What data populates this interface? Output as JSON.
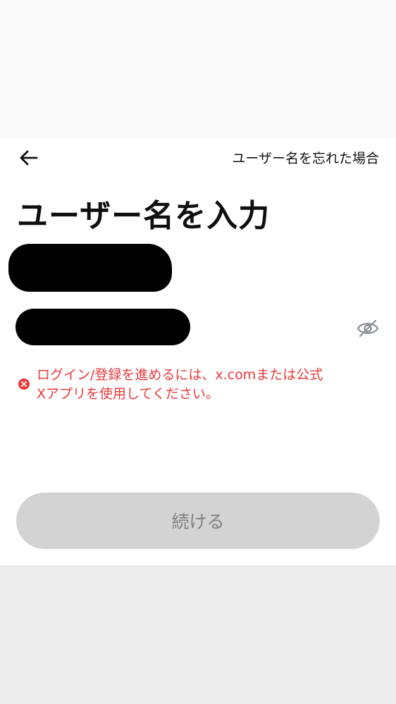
{
  "header": {
    "back_icon": "arrow-left-icon",
    "forgot_username_link": "ユーザー名を忘れた場合"
  },
  "main": {
    "title": "ユーザー名を入力",
    "password_visibility_icon": "eye-off-icon"
  },
  "error": {
    "icon": "error-x-icon",
    "line1": "ログイン/登録を進めるには、x.comまたは公式",
    "line2": "Xアプリを使用してください。"
  },
  "footer": {
    "continue_label": "続ける"
  },
  "colors": {
    "error": "#e8393b",
    "button_disabled_bg": "#d3d3d3",
    "button_disabled_text": "#7e7e7e",
    "title": "#0f0f0f"
  }
}
